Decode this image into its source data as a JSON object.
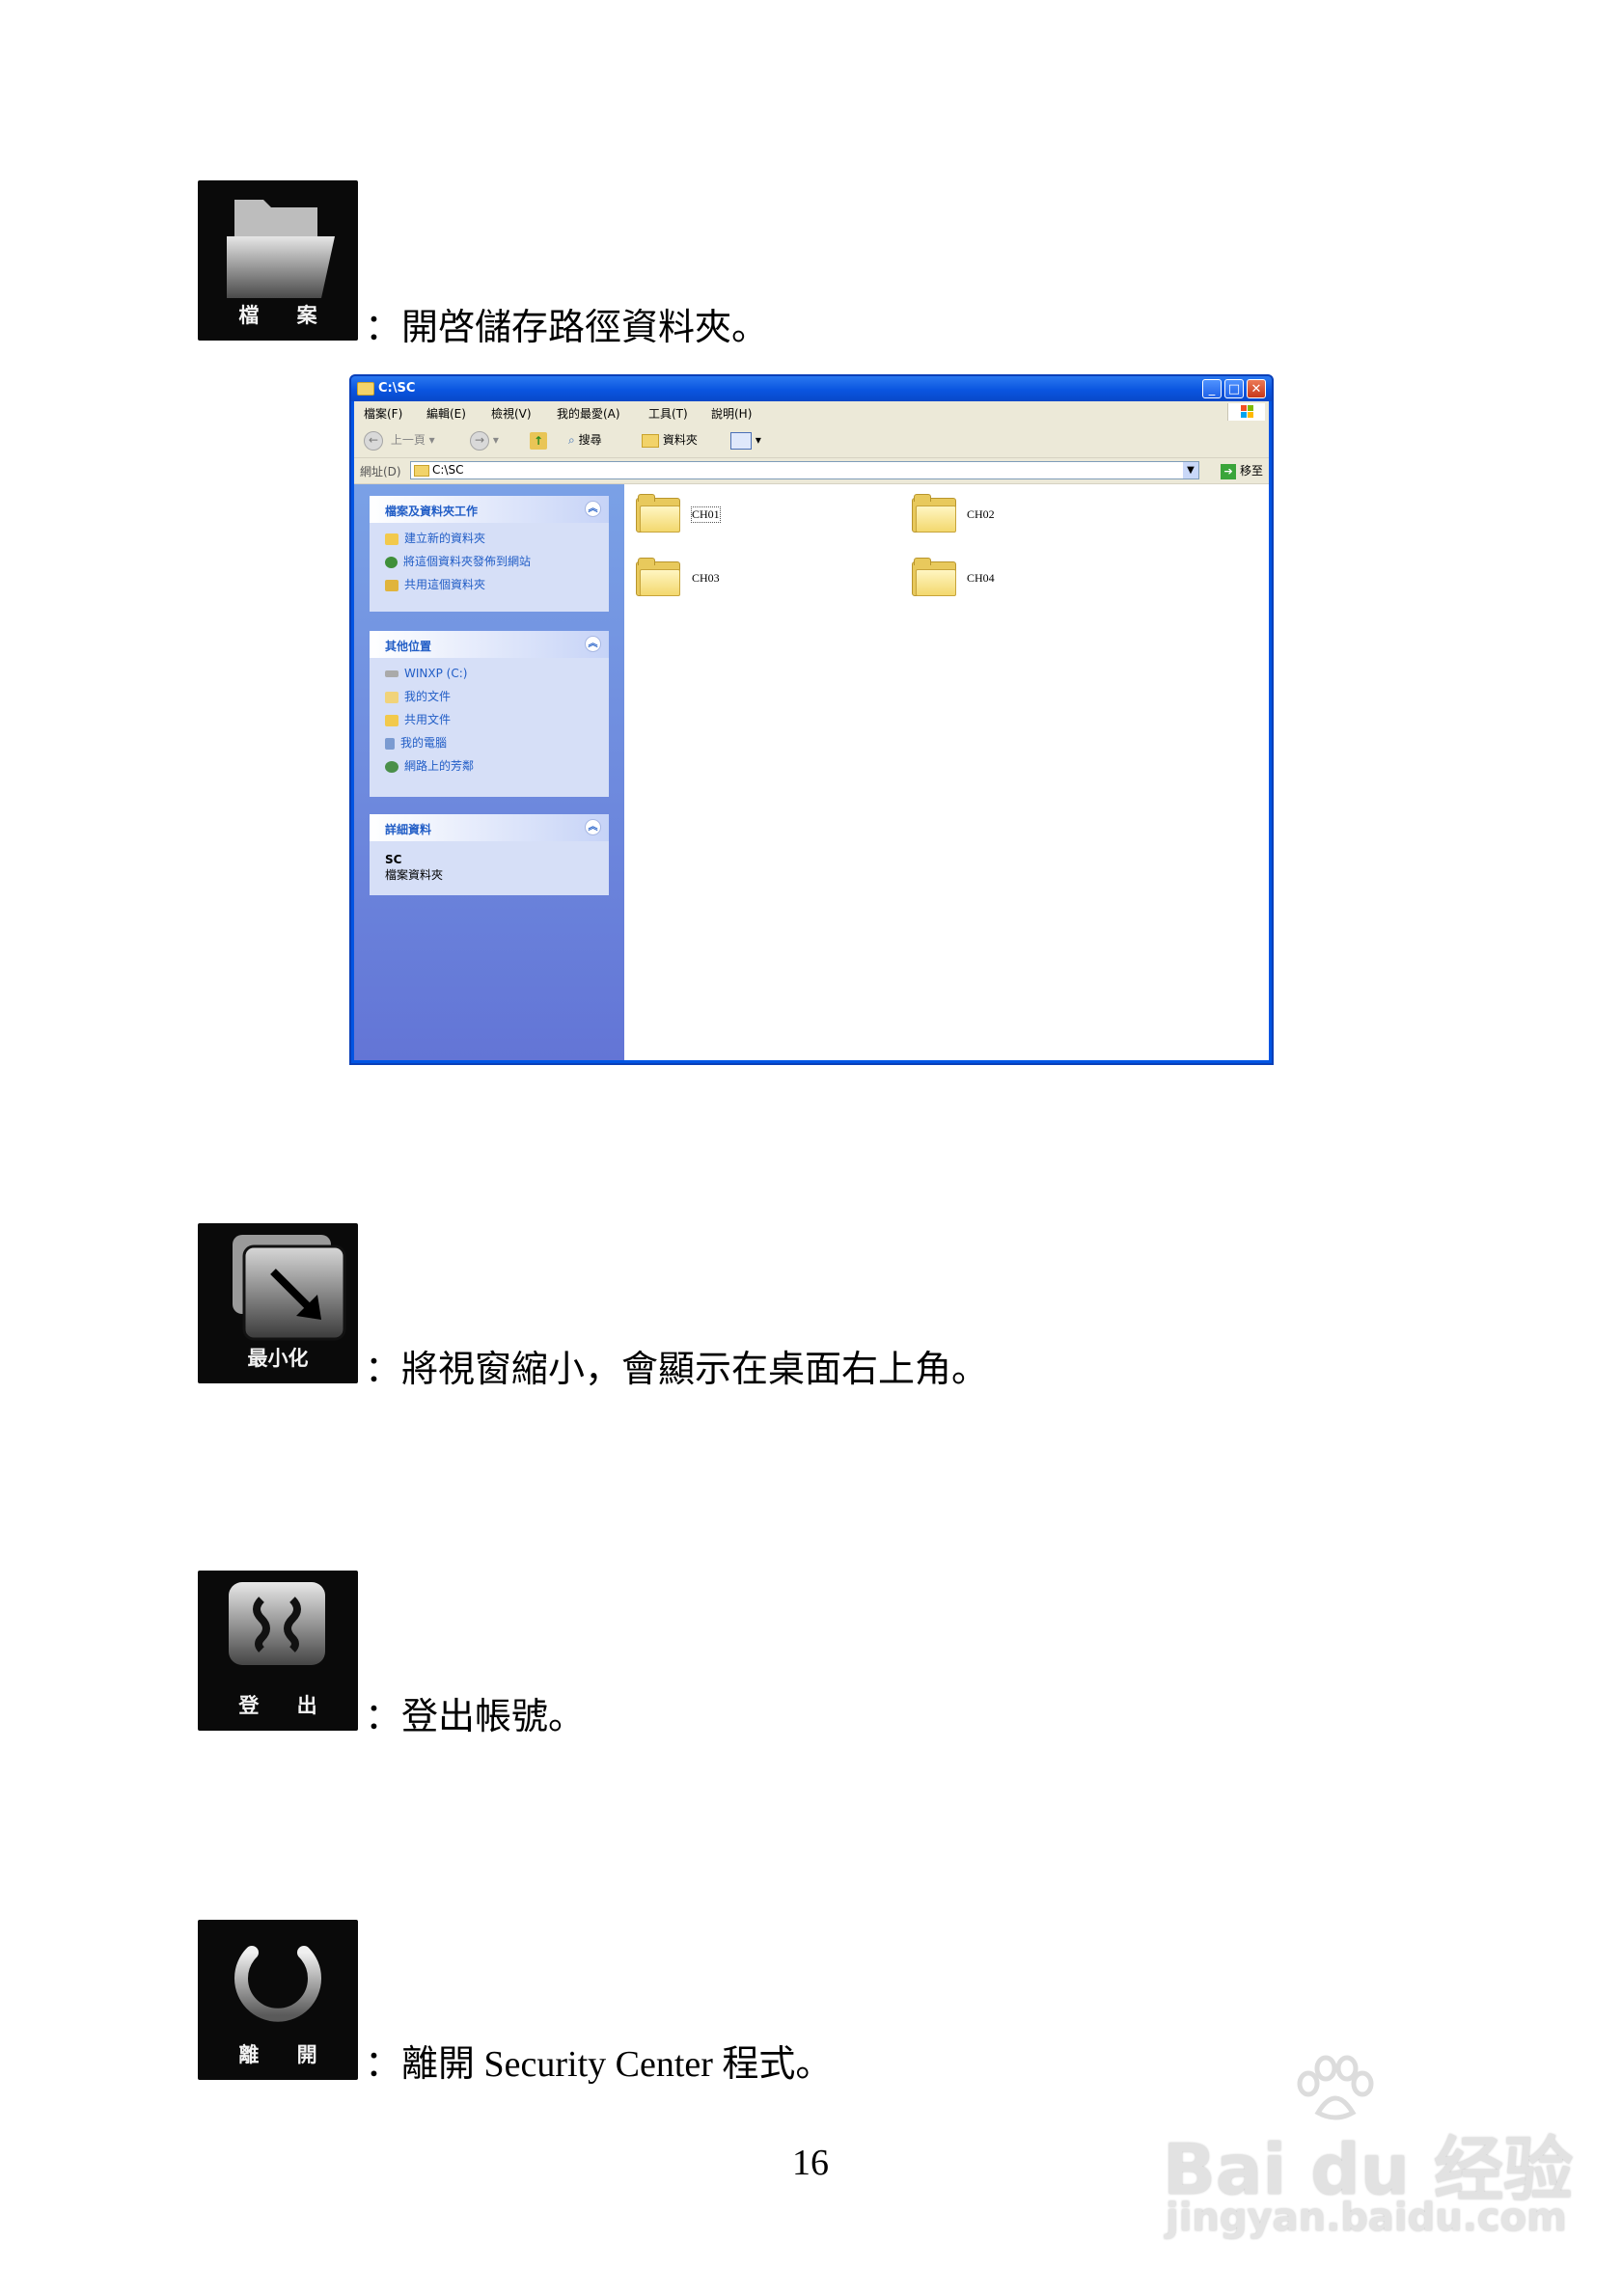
{
  "items": [
    {
      "label": "檔 案",
      "icon": "folder-icon",
      "description": "：開啓儲存路徑資料夾。"
    },
    {
      "label": "最小化",
      "icon": "minimize-icon",
      "description": "：將視窗縮小，會顯示在桌面右上角。"
    },
    {
      "label": "登 出",
      "icon": "logout-icon",
      "description": "：登出帳號。"
    },
    {
      "label": "離 開",
      "icon": "power-icon",
      "description": "：離開 Security Center 程式。"
    }
  ],
  "explorer": {
    "title": "C:\\SC",
    "menu": [
      "檔案(F)",
      "編輯(E)",
      "檢視(V)",
      "我的最愛(A)",
      "工具(T)",
      "說明(H)"
    ],
    "toolbar": {
      "back": "上一頁",
      "search": "搜尋",
      "folders": "資料夾"
    },
    "address": {
      "label": "網址(D)",
      "value": "C:\\SC",
      "go": "移至"
    },
    "panels": [
      {
        "title": "檔案及資料夾工作",
        "items": [
          "建立新的資料夾",
          "將這個資料夾發佈到網站",
          "共用這個資料夾"
        ]
      },
      {
        "title": "其他位置",
        "items": [
          "WINXP (C:)",
          "我的文件",
          "共用文件",
          "我的電腦",
          "網路上的芳鄰"
        ]
      },
      {
        "title": "詳細資料",
        "name": "SC",
        "type": "檔案資料夾"
      }
    ],
    "folders": [
      "CH01",
      "CH02",
      "CH03",
      "CH04"
    ]
  },
  "page_number": "16",
  "watermark": {
    "brand": "Bai du 经验",
    "url": "jingyan.baidu.com"
  }
}
